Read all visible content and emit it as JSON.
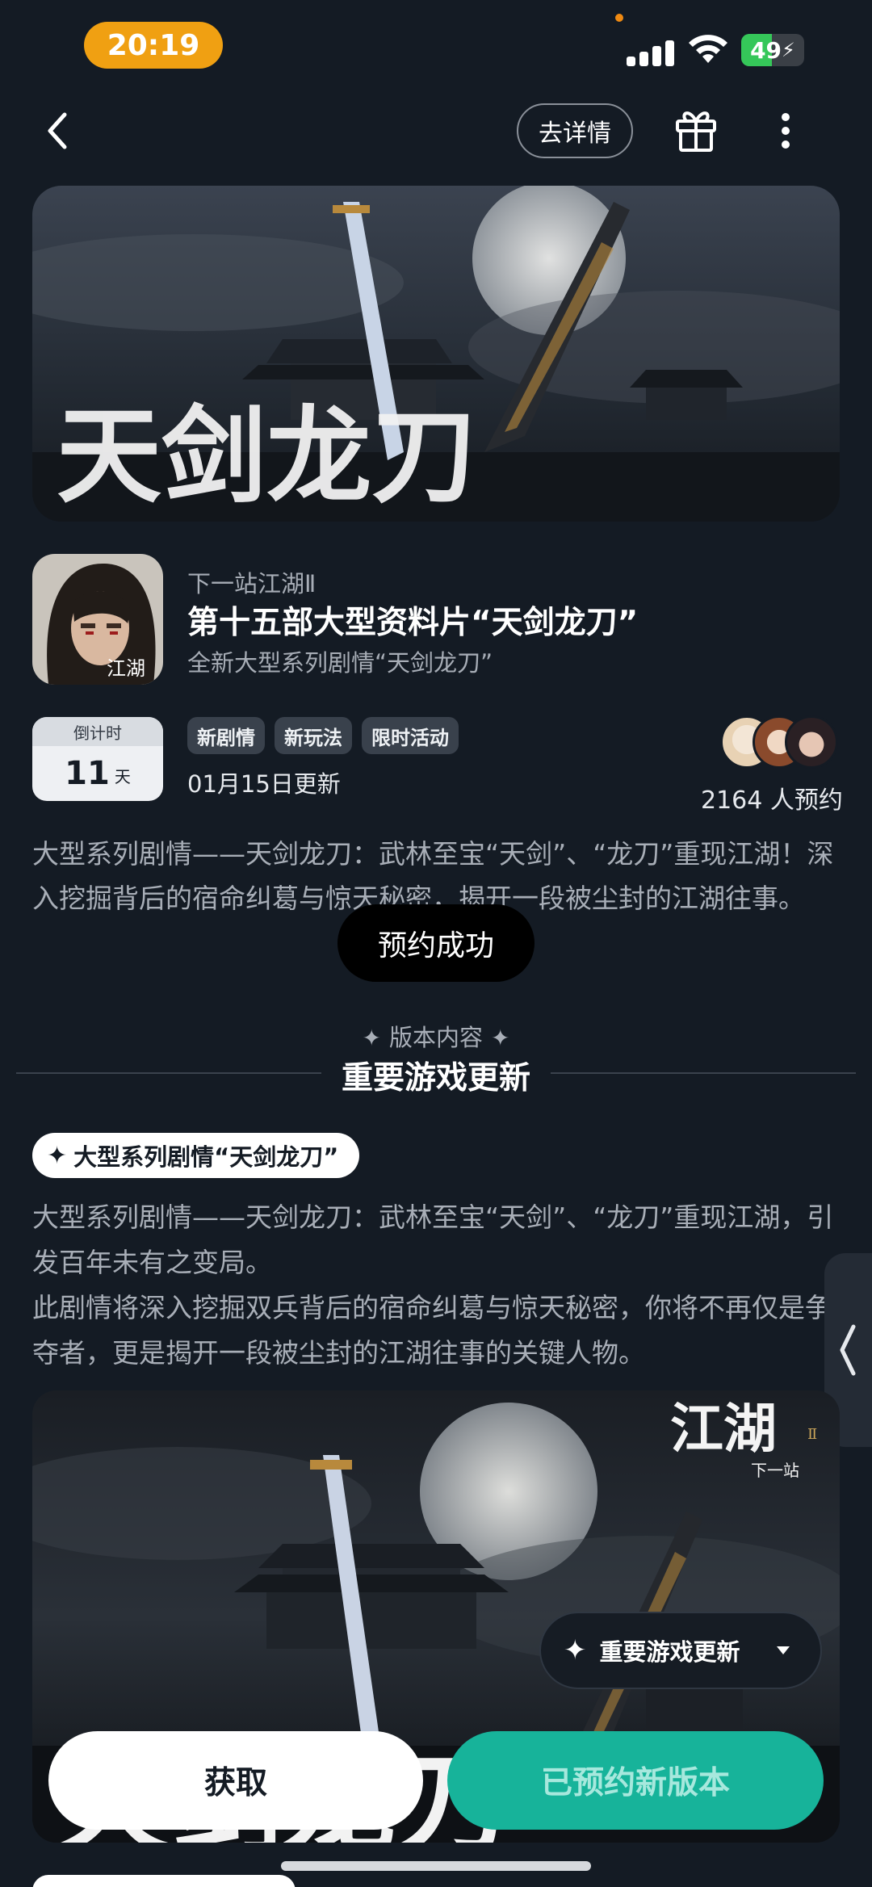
{
  "status_bar": {
    "time": "20:19",
    "battery": "49",
    "battery_level": 0.49
  },
  "nav": {
    "detail_label": "去详情"
  },
  "banner": {
    "title_art": "天剑龙刀"
  },
  "game": {
    "name": "下一站江湖Ⅱ",
    "update_title": "第十五部大型资料片“天剑龙刀”",
    "update_subtitle": "全新大型系列剧情“天剑龙刀”",
    "icon_text": "江湖"
  },
  "countdown": {
    "label": "倒计时",
    "value": "11",
    "unit": "天"
  },
  "tags": [
    "新剧情",
    "新玩法",
    "限时活动"
  ],
  "update_date": "01月15日更新",
  "reserve_count": "2164 人预约",
  "description": "大型系列剧情——天剑龙刀：武林至宝“天剑”、“龙刀”重现江湖！深入挖掘背后的宿命纠葛与惊天秘密，揭开一段被尘封的江湖往事。",
  "toast": "预约成功",
  "section": {
    "small_title": "版本内容",
    "title": "重要游戏更新"
  },
  "feature": {
    "badge": "大型系列剧情“天剑龙刀”",
    "paragraph1": "大型系列剧情——天剑龙刀：武林至宝“天剑”、“龙刀”重现江湖，引发百年未有之变局。",
    "paragraph2": "此剧情将深入挖掘双兵背后的宿命纠葛与惊天秘密，你将不再仅是争夺者，更是揭开一段被尘封的江湖往事的关键人物。"
  },
  "image2": {
    "logo_text": "江湖",
    "logo_sub": "下一站",
    "logo_numeral": "Ⅱ",
    "title_art": "天剑龙刀"
  },
  "section_dropdown": {
    "label": "重要游戏更新"
  },
  "buttons": {
    "get": "获取",
    "reserved": "已预约新版本"
  },
  "colors": {
    "background": "#141b24",
    "accent_teal": "#17b39a",
    "time_pill": "#f0a012",
    "battery_green": "#35c759"
  }
}
